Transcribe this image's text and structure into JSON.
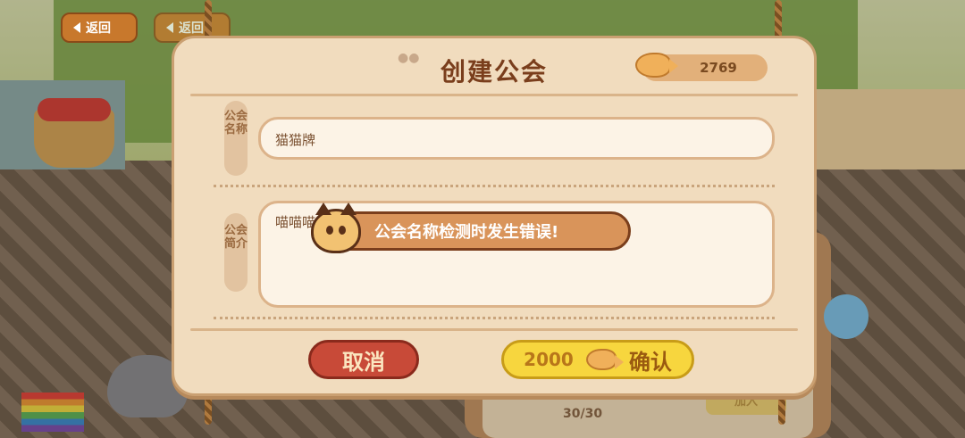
{
  "nav": {
    "back_label": "返回",
    "back_label_2": "返回"
  },
  "dialog": {
    "title": "创建公会",
    "currency_amount": "2769",
    "name_label": "公会名称",
    "name_value": "猫猫牌",
    "desc_label": "公会简介",
    "desc_value": "喵喵喵",
    "cancel_label": "取消",
    "confirm_cost": "2000",
    "confirm_label": "确认"
  },
  "toast": {
    "message": "公会名称检测时发生错误!"
  },
  "background": {
    "guild_member_count": "30/30",
    "join_label": "加入"
  },
  "colors": {
    "panel": "#f1dcbe",
    "cancel": "#c84a38",
    "confirm": "#f7d63e",
    "title": "#7a3e1c"
  },
  "icons": [
    "back-arrow-icon",
    "fish-coin-icon",
    "cat-face-icon",
    "paw-icon"
  ]
}
